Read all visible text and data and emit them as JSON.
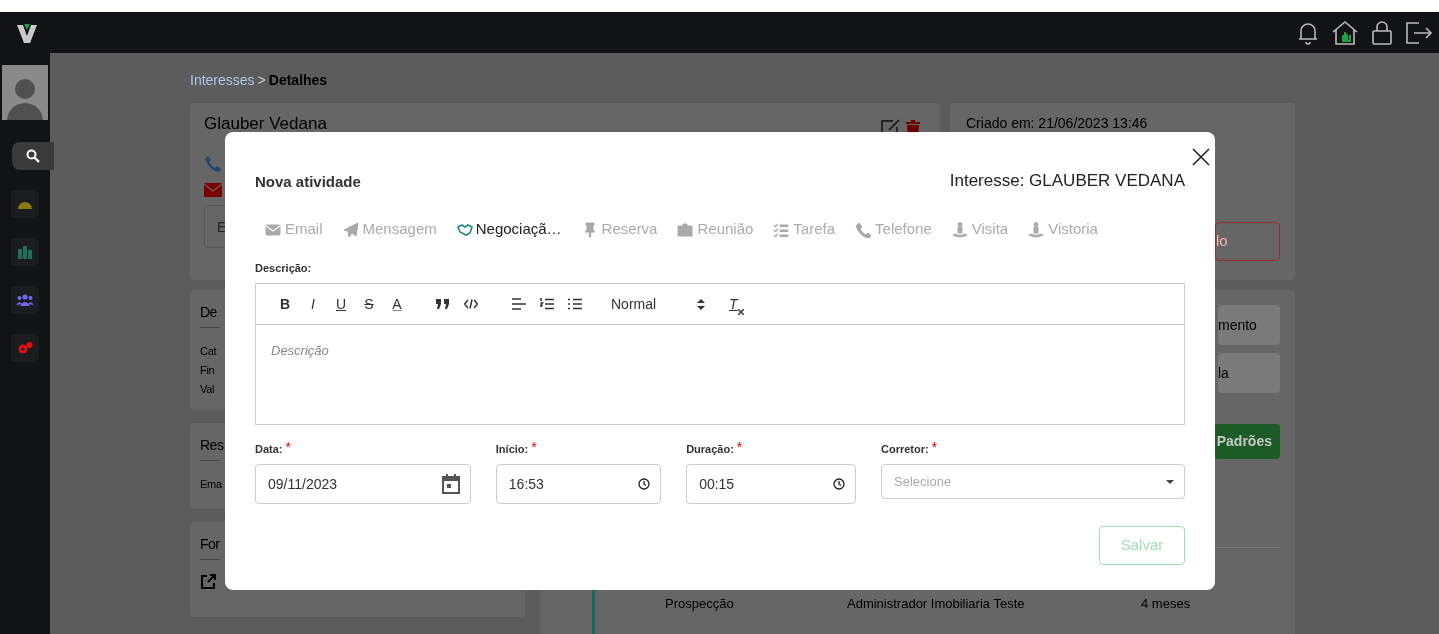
{
  "breadcrumb": {
    "parent": "Interesses",
    "separator": ">",
    "current": "Detalhes"
  },
  "lead_card": {
    "name": "Glauber Vedana",
    "input_placeholder": "E"
  },
  "info_card": {
    "created": "Criado em: 21/06/2023 13:46",
    "button": "lo"
  },
  "left_cards": [
    {
      "title": "De",
      "lines": [
        "Cat",
        "Fin",
        "Val"
      ]
    },
    {
      "title": "Res",
      "lines": [
        "Ema"
      ]
    },
    {
      "title": "For"
    }
  ],
  "right_panel": {
    "buttons": [
      "mento",
      "la"
    ],
    "green_button": "Padrões",
    "row": [
      "Prospecção",
      "Administrador Imobiliaria Teste",
      "4 meses"
    ]
  },
  "modal": {
    "title": "Nova atividade",
    "subject": "Interesse: GLAUBER VEDANA",
    "tabs": [
      {
        "label": "Email",
        "selected": false
      },
      {
        "label": "Mensagem",
        "selected": false
      },
      {
        "label": "Negociaçã…",
        "selected": true
      },
      {
        "label": "Reserva",
        "selected": false
      },
      {
        "label": "Reunião",
        "selected": false
      },
      {
        "label": "Tarefa",
        "selected": false
      },
      {
        "label": "Telefone",
        "selected": false
      },
      {
        "label": "Visita",
        "selected": false
      },
      {
        "label": "Vistoria",
        "selected": false
      }
    ],
    "description_label": "Descrição:",
    "toolbar_letters": [
      "B",
      "I",
      "U",
      "S",
      "A"
    ],
    "format_select": "Normal",
    "clear_format": "T",
    "description_placeholder": "Descrição",
    "fields": [
      {
        "kind": "date",
        "label": "Data:",
        "required_mark": "*",
        "value": "09/11/2023"
      },
      {
        "kind": "time",
        "label": "Início:",
        "required_mark": "*",
        "value": "16:53"
      },
      {
        "kind": "time",
        "label": "Duração:",
        "required_mark": "*",
        "value": "00:15"
      },
      {
        "kind": "select",
        "label": "Corretor:",
        "required_mark": "*",
        "placeholder": "Selecione"
      }
    ],
    "save_button": {
      "label": "Salvar",
      "disabled": true
    }
  }
}
